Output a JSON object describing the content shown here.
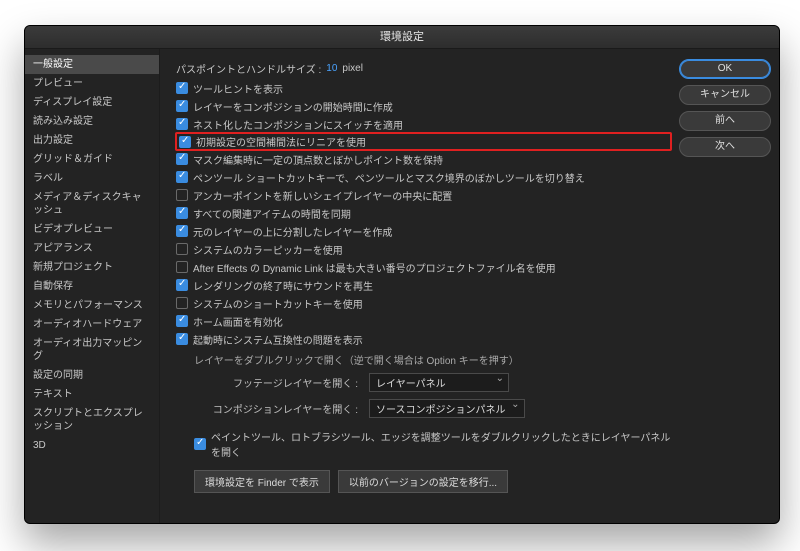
{
  "window": {
    "title": "環境設定"
  },
  "sidebar": {
    "items": [
      {
        "label": "一般設定",
        "selected": true
      },
      {
        "label": "プレビュー"
      },
      {
        "label": "ディスプレイ設定"
      },
      {
        "label": "読み込み設定"
      },
      {
        "label": "出力設定"
      },
      {
        "label": "グリッド＆ガイド"
      },
      {
        "label": "ラベル"
      },
      {
        "label": "メディア＆ディスクキャッシュ"
      },
      {
        "label": "ビデオプレビュー"
      },
      {
        "label": "アピアランス"
      },
      {
        "label": "新規プロジェクト"
      },
      {
        "label": "自動保存"
      },
      {
        "label": "メモリとパフォーマンス"
      },
      {
        "label": "オーディオハードウェア"
      },
      {
        "label": "オーディオ出力マッピング"
      },
      {
        "label": "設定の同期"
      },
      {
        "label": "テキスト"
      },
      {
        "label": "スクリプトとエクスプレッション"
      },
      {
        "label": "3D"
      }
    ]
  },
  "buttons": {
    "ok": "OK",
    "cancel": "キャンセル",
    "prev": "前へ",
    "next": "次へ"
  },
  "path_row": {
    "label": "パスポイントとハンドルサイズ :",
    "value": "10",
    "unit": "pixel"
  },
  "checks": [
    {
      "label": "ツールヒントを表示",
      "checked": true
    },
    {
      "label": "レイヤーをコンポジションの開始時間に作成",
      "checked": true
    },
    {
      "label": "ネスト化したコンポジションにスイッチを適用",
      "checked": true
    },
    {
      "label": "初期設定の空間補間法にリニアを使用",
      "checked": true,
      "highlight": true
    },
    {
      "label": "マスク編集時に一定の頂点数とぼかしポイント数を保持",
      "checked": true
    },
    {
      "label": "ペンツール ショートカットキーで、ペンツールとマスク境界のぼかしツールを切り替え",
      "checked": true
    },
    {
      "label": "アンカーポイントを新しいシェイプレイヤーの中央に配置",
      "checked": false
    },
    {
      "label": "すべての関連アイテムの時間を同期",
      "checked": true
    },
    {
      "label": "元のレイヤーの上に分割したレイヤーを作成",
      "checked": true
    },
    {
      "label": "システムのカラーピッカーを使用",
      "checked": false
    },
    {
      "label": "After Effects の Dynamic Link は最も大きい番号のプロジェクトファイル名を使用",
      "checked": false
    },
    {
      "label": "レンダリングの終了時にサウンドを再生",
      "checked": true
    },
    {
      "label": "システムのショートカットキーを使用",
      "checked": false
    },
    {
      "label": "ホーム画面を有効化",
      "checked": true
    },
    {
      "label": "起動時にシステム互換性の問題を表示",
      "checked": true
    }
  ],
  "dblclick": {
    "title": "レイヤーをダブルクリックで開く（逆で開く場合は Option キーを押す）",
    "footage_label": "フッテージレイヤーを開く :",
    "footage_value": "レイヤーパネル",
    "comp_label": "コンポジションレイヤーを開く :",
    "comp_value": "ソースコンポジションパネル",
    "paint_check": {
      "label": "ペイントツール、ロトブラシツール、エッジを調整ツールをダブルクリックしたときにレイヤーパネルを開く",
      "checked": true
    }
  },
  "footer": {
    "reveal": "環境設定を Finder で表示",
    "migrate": "以前のバージョンの設定を移行..."
  }
}
